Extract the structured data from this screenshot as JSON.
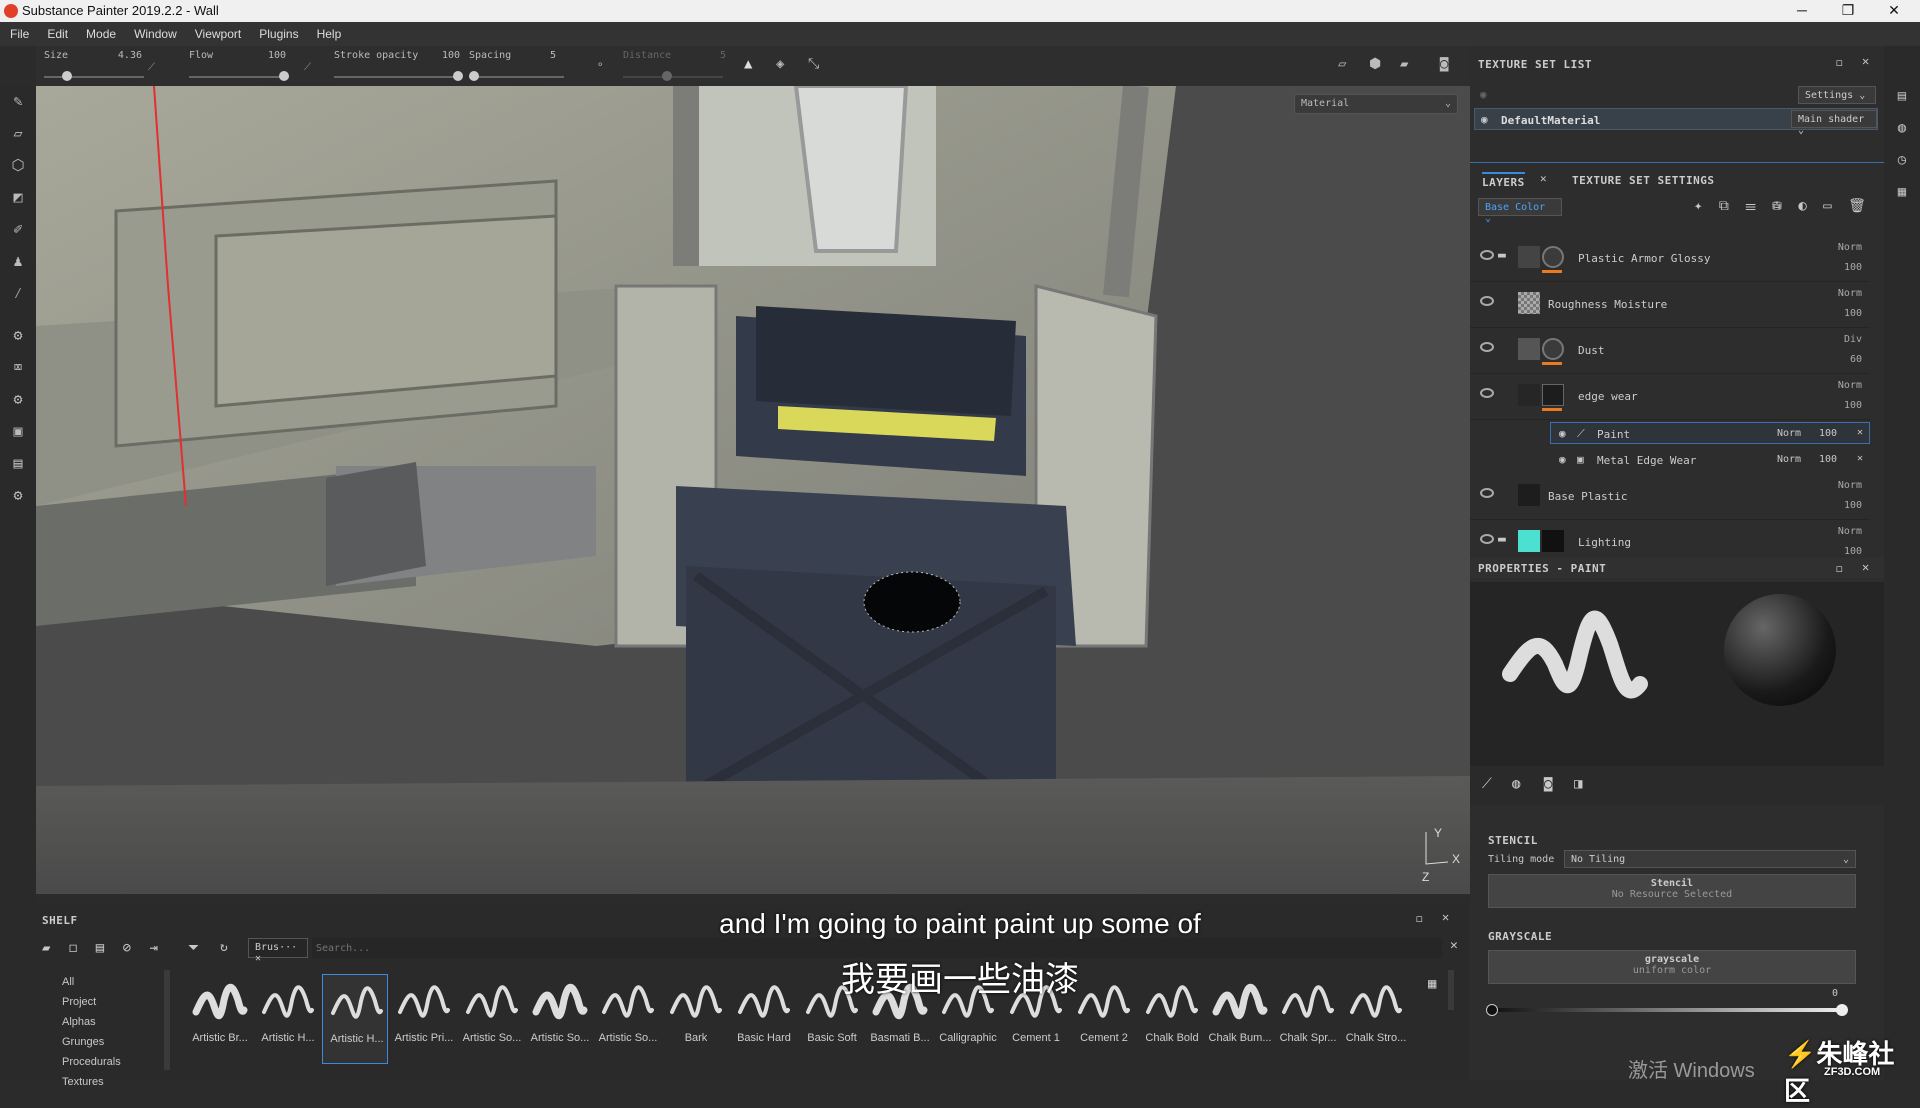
{
  "window": {
    "title": "Substance Painter 2019.2.2 - Wall",
    "minimize": "─",
    "maximize": "❐",
    "close": "✕"
  },
  "menu": [
    "File",
    "Edit",
    "Mode",
    "Window",
    "Viewport",
    "Plugins",
    "Help"
  ],
  "toolbar": {
    "size_label": "Size",
    "size_value": "4.36",
    "flow_label": "Flow",
    "flow_value": "100",
    "stroke_label": "Stroke opacity",
    "stroke_value": "100",
    "spacing_label": "Spacing",
    "spacing_value": "5",
    "distance_label": "Distance",
    "distance_value": "5"
  },
  "viewport": {
    "mode": "Material",
    "axis_x": "X",
    "axis_y": "Y",
    "axis_z": "Z"
  },
  "texture_set_list": {
    "title": "TEXTURE SET LIST",
    "settings": "Settings",
    "material": "DefaultMaterial",
    "shader": "Main shader"
  },
  "tabs": {
    "layers": "LAYERS",
    "texture_set_settings": "TEXTURE SET SETTINGS"
  },
  "channel": "Base Color",
  "layers": [
    {
      "name": "Plastic Armor Glossy",
      "blend": "Norm",
      "opacity": "100"
    },
    {
      "name": "Roughness Moisture",
      "blend": "Norm",
      "opacity": "100"
    },
    {
      "name": "Dust",
      "blend": "Div",
      "opacity": "60"
    },
    {
      "name": "edge wear",
      "blend": "Norm",
      "opacity": "100"
    },
    {
      "name": "Base Plastic",
      "blend": "Norm",
      "opacity": "100"
    },
    {
      "name": "Lighting",
      "blend": "Norm",
      "opacity": "100"
    }
  ],
  "sublayers": [
    {
      "name": "Paint",
      "blend": "Norm",
      "opacity": "100"
    },
    {
      "name": "Metal Edge Wear",
      "blend": "Norm",
      "opacity": "100"
    }
  ],
  "properties": {
    "title": "PROPERTIES - PAINT",
    "stencil_title": "STENCIL",
    "tiling_label": "Tiling mode",
    "tiling_value": "No Tiling",
    "stencil_btn": "Stencil",
    "stencil_sub": "No Resource Selected",
    "grayscale_title": "GRAYSCALE",
    "grayscale_btn": "grayscale",
    "grayscale_sub": "uniform color",
    "grayscale_value": "0",
    "grayscale_fraction": 1.0
  },
  "shelf": {
    "title": "SHELF",
    "filter_tag": "Brus···",
    "search_placeholder": "Search...",
    "categories": [
      "All",
      "Project",
      "Alphas",
      "Grunges",
      "Procedurals",
      "Textures"
    ],
    "brushes": [
      "Artistic Br...",
      "Artistic H...",
      "Artistic H...",
      "Artistic Pri...",
      "Artistic So...",
      "Artistic So...",
      "Artistic So...",
      "Bark",
      "Basic Hard",
      "Basic Soft",
      "Basmati B...",
      "Calligraphic",
      "Cement 1",
      "Cement 2",
      "Chalk Bold",
      "Chalk Bum...",
      "Chalk Spr...",
      "Chalk Stro..."
    ]
  },
  "subtitles": {
    "en": "and I'm going to paint paint up some of",
    "zh": "我要画一些油漆"
  },
  "watermark": {
    "windows": "激活 Windows",
    "brand": "朱峰社区",
    "brand_url": "ZF3D.COM"
  }
}
